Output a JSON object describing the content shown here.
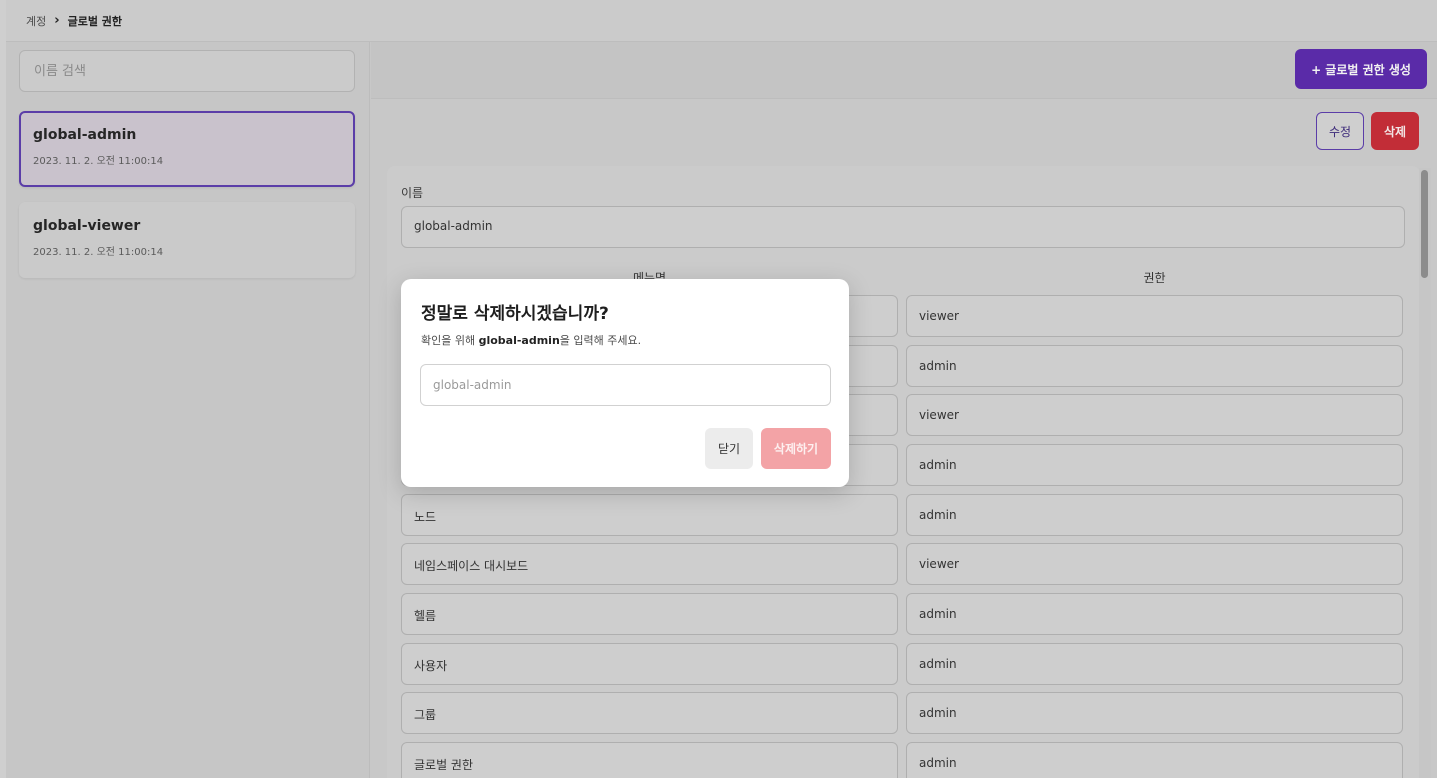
{
  "breadcrumb": {
    "parent": "계정",
    "separator": "›",
    "current": "글로벌 권한"
  },
  "sidebar": {
    "search_placeholder": "이름 검색",
    "items": [
      {
        "name": "global-admin",
        "date": "2023. 11. 2. 오전 11:00:14",
        "selected": true
      },
      {
        "name": "global-viewer",
        "date": "2023. 11. 2. 오전 11:00:14",
        "selected": false
      }
    ]
  },
  "header": {
    "create_label": "+ 글로벌 권한 생성"
  },
  "actions": {
    "edit_label": "수정",
    "delete_label": "삭제"
  },
  "detail": {
    "name_label": "이름",
    "name_value": "global-admin",
    "col_menu": "메뉴명",
    "col_perm": "권한",
    "rows": [
      {
        "menu": "",
        "perm": "viewer"
      },
      {
        "menu": "",
        "perm": "admin"
      },
      {
        "menu": "",
        "perm": "viewer"
      },
      {
        "menu": "",
        "perm": "admin"
      },
      {
        "menu": "노드",
        "perm": "admin"
      },
      {
        "menu": "네임스페이스 대시보드",
        "perm": "viewer"
      },
      {
        "menu": "헬름",
        "perm": "admin"
      },
      {
        "menu": "사용자",
        "perm": "admin"
      },
      {
        "menu": "그룹",
        "perm": "admin"
      },
      {
        "menu": "글로벌 권한",
        "perm": "admin"
      }
    ]
  },
  "modal": {
    "title": "정말로 삭제하시겠습니까?",
    "desc_prefix": "확인을 위해 ",
    "desc_target": "global-admin",
    "desc_suffix": "을 입력해 주세요.",
    "input_placeholder": "global-admin",
    "close_label": "닫기",
    "confirm_label": "삭제하기"
  },
  "colors": {
    "accent": "#5a2ba8",
    "danger": "#c22d37",
    "danger_disabled": "#f3a3a6"
  }
}
